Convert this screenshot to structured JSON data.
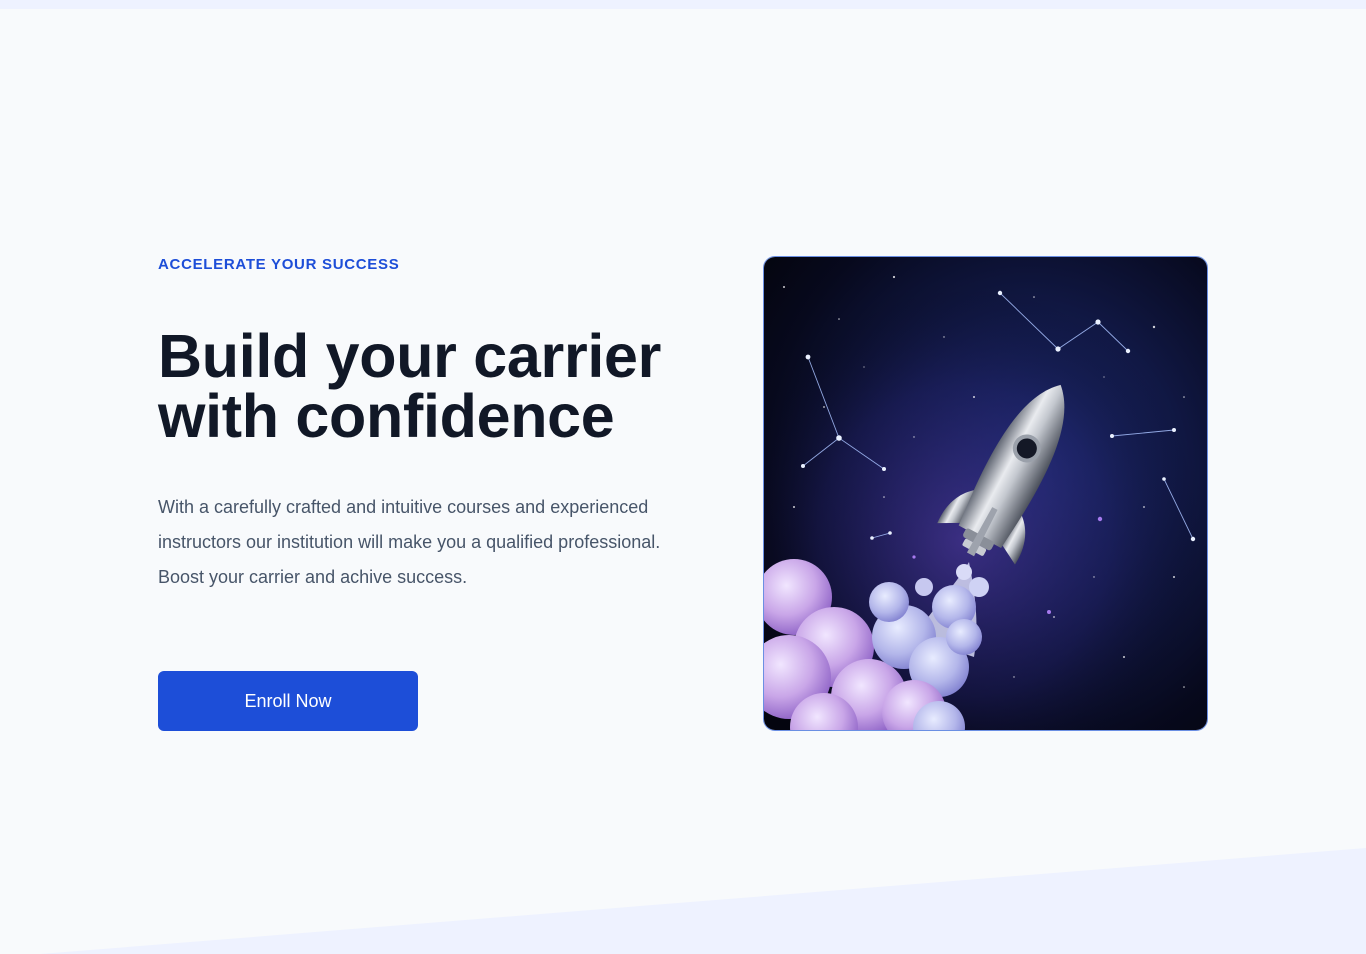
{
  "hero": {
    "eyebrow": "ACCELERATE YOUR SUCCESS",
    "headline_line1": "Build your carrier",
    "headline_line2": "with confidence",
    "description": "With a carefully crafted and intuitive courses and experienced instructors our institution will make you a qualified professional. Boost your carrier and achive success.",
    "cta_label": "Enroll Now",
    "image_name": "rocket-launch-illustration"
  },
  "colors": {
    "accent": "#1d4ed8",
    "heading": "#111827",
    "body_text": "#475569",
    "page_background": "#f8fafc",
    "wedge": "#eef2ff"
  }
}
